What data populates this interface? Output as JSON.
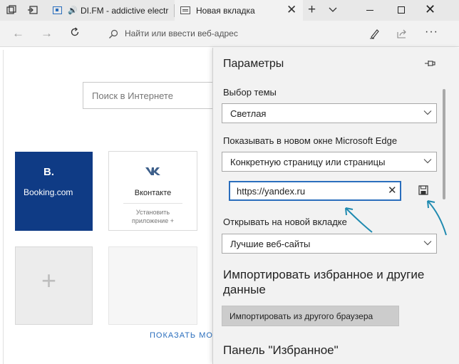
{
  "window": {
    "tabs": [
      {
        "title": "DI.FM - addictive electr",
        "audio_icon": "🔊"
      },
      {
        "title": "Новая вкладка"
      }
    ],
    "close_tab_glyph": "✕",
    "new_tab_glyph": "+",
    "window_close_glyph": "✕"
  },
  "navbar": {
    "back_glyph": "←",
    "forward_glyph": "→",
    "address_placeholder": "Найти или ввести веб-адрес",
    "more_glyph": "···"
  },
  "newtab": {
    "search_placeholder": "Поиск в Интернете",
    "tiles": [
      {
        "logo": "B.",
        "name": "Booking.com"
      },
      {
        "name": "Вконтакте",
        "install_line1": "Установить",
        "install_line2": "приложение +"
      }
    ],
    "add_glyph": "+",
    "show_more": "ПОКАЗАТЬ МО"
  },
  "settings": {
    "title": "Параметры",
    "theme_label": "Выбор темы",
    "theme_value": "Светлая",
    "open_with_label": "Показывать в новом окне Microsoft Edge",
    "open_with_value": "Конкретную страницу или страницы",
    "url_value": "https://yandex.ru",
    "url_clear_glyph": "✕",
    "newtab_label": "Открывать на новой вкладке",
    "newtab_value": "Лучшие веб-сайты",
    "import_heading_line1": "Импортировать избранное и другие",
    "import_heading_line2": "данные",
    "import_button": "Импортировать из другого браузера",
    "favorites_heading": "Панель \"Избранное\""
  },
  "colors": {
    "accent": "#2a6ebd",
    "booking": "#0f3b85",
    "annotation_arrow": "#1f8ab0"
  }
}
